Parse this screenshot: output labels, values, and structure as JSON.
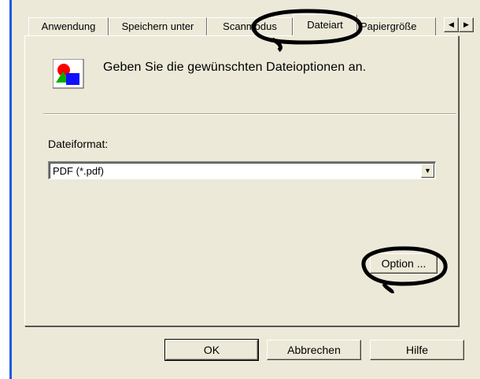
{
  "tabs": [
    {
      "label": "Anwendung"
    },
    {
      "label": "Speichern unter"
    },
    {
      "label": "Scanmodus"
    },
    {
      "label": "Dateiart",
      "active": true
    },
    {
      "label": "Papiergröße"
    }
  ],
  "header": {
    "text": "Geben Sie die gewünschten Dateioptionen an."
  },
  "file_format": {
    "label": "Dateiformat:",
    "value": "PDF (*.pdf)"
  },
  "option_button": {
    "label": "Option ..."
  },
  "footer": {
    "ok": "OK",
    "cancel": "Abbrechen",
    "help": "Hilfe"
  },
  "colors": {
    "accent_blue": "#1c5ae0",
    "dialog_bg": "#ece9d8",
    "highlight_mark": "#000000"
  }
}
